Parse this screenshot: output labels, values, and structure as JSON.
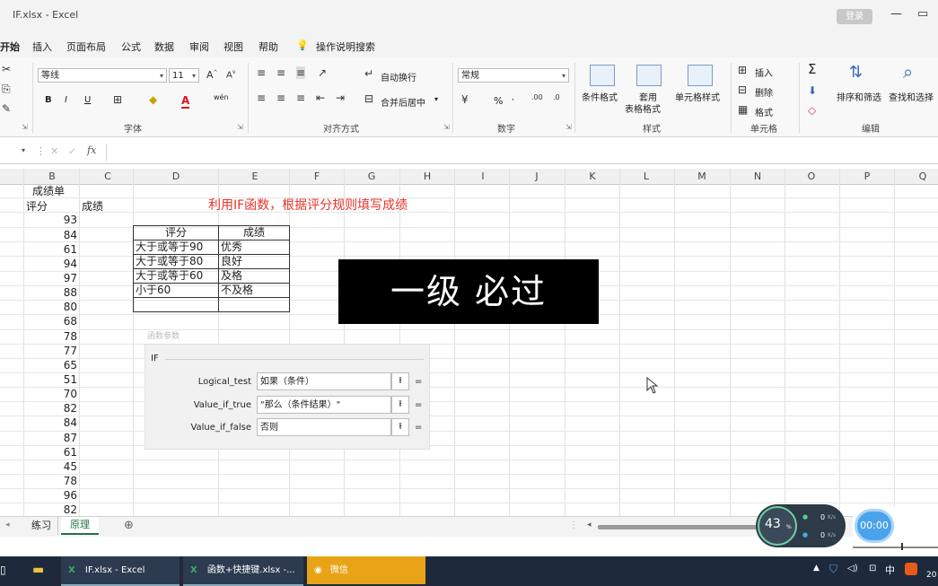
{
  "window": {
    "title": "IF.xlsx - Excel",
    "login_label": "登录"
  },
  "menu": {
    "tabs": [
      "开始",
      "插入",
      "页面布局",
      "公式",
      "数据",
      "审阅",
      "视图",
      "帮助"
    ],
    "search": "操作说明搜索"
  },
  "ribbon": {
    "font": {
      "name": "等线",
      "size": "11",
      "group_label": "字体",
      "bold": "B",
      "italic": "I",
      "underline": "U",
      "font_color_glyph": "A",
      "phonetic": "wén"
    },
    "align": {
      "wrap": "自动换行",
      "merge": "合并后居中",
      "group_label": "对齐方式"
    },
    "number": {
      "format": "常规",
      "percent": "%",
      "group_label": "数字"
    },
    "styles": {
      "cond": "条件格式",
      "table_line1": "套用",
      "table_line2": "表格格式",
      "cell_styles": "单元格样式",
      "group_label": "样式"
    },
    "cells": {
      "insert": "插入",
      "delete": "删除",
      "format": "格式",
      "group_label": "单元格"
    },
    "editing": {
      "sort": "排序和筛选",
      "find": "查找和选择",
      "group_label": "编辑",
      "sum_glyph": "Σ"
    }
  },
  "formula_bar": {
    "fx": "fx",
    "content": ""
  },
  "columns": [
    "B",
    "C",
    "D",
    "E",
    "F",
    "G",
    "H",
    "I",
    "J",
    "K",
    "L",
    "M",
    "N",
    "O",
    "P",
    "Q"
  ],
  "sheet": {
    "title_cell": "成绩单",
    "header_score": "评分",
    "header_grade": "成绩",
    "heading": "利用IF函数，根据评分规则填写成绩",
    "scores": [
      "93",
      "84",
      "61",
      "94",
      "97",
      "88",
      "80",
      "68",
      "78",
      "77",
      "65",
      "51",
      "70",
      "82",
      "84",
      "87",
      "61",
      "45",
      "78",
      "96",
      "82"
    ]
  },
  "rules_table": {
    "headers": [
      "评分",
      "成绩"
    ],
    "rows": [
      [
        "大于或等于90",
        "优秀"
      ],
      [
        "大于或等于80",
        "良好"
      ],
      [
        "大于或等于60",
        "及格"
      ],
      [
        "小于60",
        "不及格"
      ],
      [
        "",
        ""
      ]
    ]
  },
  "dialog": {
    "caption": "函数参数",
    "function_name": "IF",
    "args": [
      {
        "label": "Logical_test",
        "value": "如果（条件）"
      },
      {
        "label": "Value_if_true",
        "value": "\"那么（条件结果）\""
      },
      {
        "label": "Value_if_false",
        "value": "否则"
      }
    ],
    "eq": "="
  },
  "overlay": {
    "text": "一级 必过"
  },
  "sheet_tabs": {
    "tabs": [
      "练习",
      "原理"
    ],
    "active": "原理",
    "add": "⊕"
  },
  "player": {
    "percent": "43",
    "percent_unit": "%",
    "net_up": "0",
    "net_up_unit": "K/s",
    "net_down": "0",
    "net_down_unit": "K/s",
    "time": "00:00"
  },
  "taskbar": {
    "items": [
      "IF.xlsx - Excel",
      "函数+快捷键.xlsx -...",
      "微信"
    ],
    "lang": "中",
    "clock": "20"
  },
  "colors": {
    "accent_red": "#e8332a",
    "taskbar": "#1e2a3b",
    "wechat": "#e8a317",
    "sheet_tab_active": "#217346"
  }
}
